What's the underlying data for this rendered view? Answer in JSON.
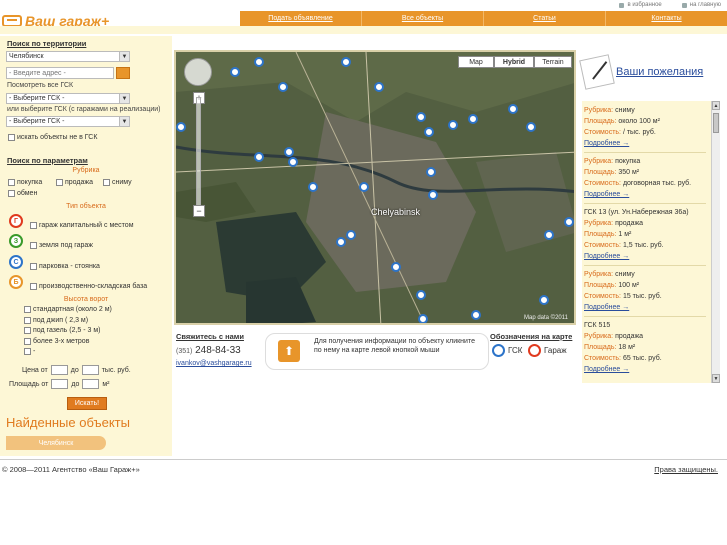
{
  "header": {
    "logo_text": "Ваш гараж+",
    "top_links": [
      {
        "label": "в избранное",
        "icon": "star-icon"
      },
      {
        "label": "на главную",
        "icon": "home-icon"
      }
    ],
    "nav": [
      "Подать объявление",
      "Все объекты",
      "Статьи",
      "Контакты"
    ]
  },
  "territory": {
    "title": "Поиск по территории",
    "city_select": "Челябинск",
    "address_placeholder": "- Введите адрес -",
    "see_all_gsk": "Посмотреть все ГСК",
    "gsk_select": "- Выберите ГСК -",
    "or_select_text": "или выберите ГСК (с гаражами на реализации)",
    "gsk_select2": "- Выберите ГСК -",
    "outside_gsk": "искать объекты не в ГСК"
  },
  "params": {
    "title": "Поиск по параметрам",
    "rubric_label": "Рубрика",
    "rubrics": [
      "покупка",
      "продажа",
      "сниму",
      "обмен"
    ],
    "type_label": "Тип объекта",
    "types": [
      {
        "label": "гараж капитальный с местом",
        "icon_letter": "Г",
        "color": "#e03a1f"
      },
      {
        "label": "земля под гараж",
        "icon_letter": "З",
        "color": "#3a9a2a"
      },
      {
        "label": "парковка - стоянка",
        "icon_letter": "С",
        "color": "#2d74c9"
      },
      {
        "label": "производственно-складская база",
        "icon_letter": "Б",
        "color": "#e8952a"
      }
    ],
    "height_label": "Высота ворот",
    "heights": [
      "стандартная (около 2 м)",
      "под джип ( 2,3 м)",
      "под газель (2,5 - 3 м)",
      "более 3-х метров",
      "-"
    ],
    "price_label": "Цена от",
    "price_to": "до",
    "price_unit": "тыс. руб.",
    "area_label": "Площадь от",
    "area_to": "до",
    "area_unit": "м²",
    "search_button": "Искать!"
  },
  "found": {
    "title": "Найденные объекты",
    "chip": "Челябинск"
  },
  "map": {
    "types": [
      "Map",
      "Hybrid",
      "Terrain"
    ],
    "city_label": "Chelyabinsk",
    "copyright": "Map data ©2011"
  },
  "contact": {
    "title": "Свяжитесь с нами",
    "phone_code": "(351)",
    "phone": "248-84-33",
    "email": "ivankov@vashgarage.ru"
  },
  "info": {
    "text": "Для получения информации по объекту кликните по нему на карте левой кнопкой мыши"
  },
  "legend": {
    "title": "Обозначения на карте",
    "items": [
      {
        "label": "ГСК",
        "color": "#2d74c9"
      },
      {
        "label": "Гараж",
        "color": "#e03a1f"
      }
    ]
  },
  "wishes": {
    "label": "Ваши пожелания"
  },
  "listings": [
    {
      "heading": "",
      "rubric_k": "Рубрика:",
      "rubric": "сниму",
      "area_k": "Площадь:",
      "area": "около 100 м²",
      "cost_k": "Стоимость:",
      "cost": "/ тыс. руб.",
      "more": "Подробнее →"
    },
    {
      "heading": "",
      "rubric_k": "Рубрика:",
      "rubric": "покупка",
      "area_k": "Площадь:",
      "area": "350 м²",
      "cost_k": "Стоимость:",
      "cost": "договорная тыс. руб.",
      "more": "Подробнее →"
    },
    {
      "heading": "ГСК 13 (ул. Ун.Набережная 36а)",
      "rubric_k": "Рубрика:",
      "rubric": "продажа",
      "area_k": "Площадь:",
      "area": "1 м²",
      "cost_k": "Стоимость:",
      "cost": "1,5 тыс. руб.",
      "more": "Подробнее →"
    },
    {
      "heading": "",
      "rubric_k": "Рубрика:",
      "rubric": "сниму",
      "area_k": "Площадь:",
      "area": "100 м²",
      "cost_k": "Стоимость:",
      "cost": "15 тыс. руб.",
      "more": "Подробнее →"
    },
    {
      "heading": "ГСК 515",
      "rubric_k": "Рубрика:",
      "rubric": "продажа",
      "area_k": "Площадь:",
      "area": "18 м²",
      "cost_k": "Стоимость:",
      "cost": "65 тыс. руб.",
      "more": "Подробнее →"
    }
  ],
  "footer": {
    "copyright": "© 2008—2011 Агентство «Ваш Гараж+»",
    "rights": "Права защищены."
  }
}
